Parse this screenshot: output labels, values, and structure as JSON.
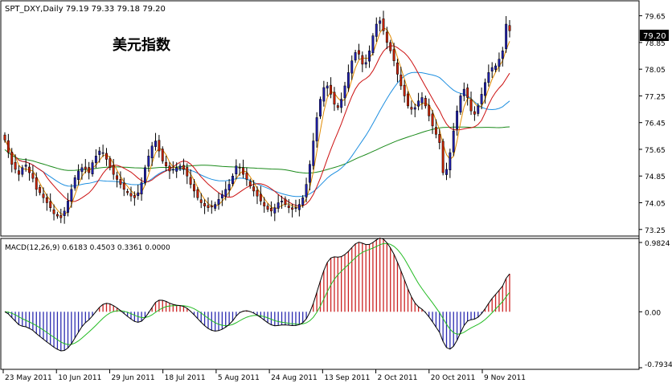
{
  "chart_data": [
    {
      "type": "candlestick",
      "header_text": "SPT_DXY,Daily  79.19 79.33 79.18 79.20",
      "title": "美元指数",
      "last_price_label": "79.20",
      "y_ticks": [
        "79.65",
        "78.85",
        "78.05",
        "77.25",
        "76.45",
        "75.65",
        "74.85",
        "74.05",
        "73.25"
      ],
      "ylim": [
        73.1,
        80.05
      ],
      "colors": {
        "bull": "#1f1fb0",
        "bear": "#cc2200",
        "sma_short": "#e08a00",
        "sma_mid": "#cc1111",
        "sma_long_blue": "#1e8fe0",
        "sma_long_green": "#1a8a1a"
      },
      "close": [
        75.93,
        75.55,
        75.2,
        75.05,
        74.9,
        75.1,
        75.18,
        74.95,
        74.78,
        74.45,
        74.35,
        74.2,
        74.05,
        73.9,
        73.72,
        73.65,
        73.6,
        73.8,
        74.1,
        74.45,
        74.8,
        75.0,
        75.1,
        75.05,
        74.95,
        75.25,
        75.45,
        75.6,
        75.55,
        75.35,
        75.1,
        74.9,
        74.75,
        74.6,
        74.45,
        74.35,
        74.25,
        74.2,
        74.35,
        74.65,
        75.1,
        75.45,
        75.75,
        75.9,
        75.6,
        75.3,
        75.15,
        75.0,
        75.05,
        75.1,
        75.15,
        75.05,
        74.85,
        74.6,
        74.4,
        74.2,
        74.05,
        73.95,
        73.9,
        73.92,
        74.0,
        74.15,
        74.3,
        74.45,
        74.6,
        74.85,
        75.15,
        75.1,
        74.9,
        74.75,
        74.55,
        74.4,
        74.25,
        74.1,
        73.95,
        73.85,
        73.8,
        73.9,
        74.05,
        74.1,
        74.0,
        73.9,
        73.85,
        73.9,
        74.0,
        74.2,
        74.6,
        75.2,
        75.9,
        76.6,
        77.15,
        77.5,
        77.55,
        77.3,
        77.0,
        76.9,
        77.15,
        77.55,
        77.95,
        78.3,
        78.55,
        78.5,
        78.2,
        78.25,
        78.6,
        79.05,
        79.4,
        79.5,
        79.2,
        78.85,
        78.6,
        78.3,
        77.9,
        77.55,
        77.25,
        76.95,
        76.85,
        76.9,
        77.1,
        77.2,
        76.95,
        76.65,
        76.35,
        76.1,
        75.85,
        74.95,
        75.05,
        75.55,
        76.2,
        76.8,
        77.25,
        77.45,
        77.2,
        76.8,
        76.7,
        76.95,
        77.3,
        77.65,
        77.95,
        78.1,
        78.15,
        78.35,
        78.6,
        79.4,
        79.2
      ],
      "series": [
        {
          "values": "sma_short"
        },
        {
          "values": "sma_mid"
        },
        {
          "values": "sma_long"
        }
      ]
    },
    {
      "type": "macd",
      "header_text": "MACD(12,26,9) 0.6183 0.4503 0.3361 0.0000",
      "y_ticks": [
        "0.9824",
        "0.00",
        "-0.7934"
      ],
      "ylim": [
        -0.7934,
        0.9824
      ],
      "colors": {
        "hist_pos": "#cc2222",
        "hist_neg": "#2a2ab0",
        "macd_line": "#000000",
        "signal_line": "#22bb22"
      }
    }
  ],
  "x_axis": {
    "date_labels": [
      "23 May 2011",
      "10 Jun 2011",
      "29 Jun 2011",
      "18 Jul 2011",
      "5 Aug 2011",
      "24 Aug 2011",
      "13 Sep 2011",
      "2 Oct 2011",
      "20 Oct 2011",
      "9 Nov 2011"
    ]
  }
}
